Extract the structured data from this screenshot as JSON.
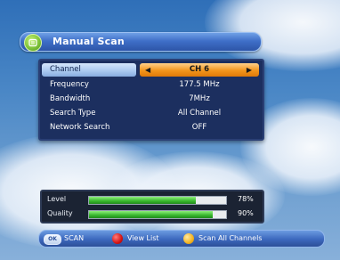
{
  "title": {
    "text": "Manual Scan",
    "icon": "satellite-dish-icon"
  },
  "settings": [
    {
      "label": "Channel",
      "value": "CH 6",
      "selected": true
    },
    {
      "label": "Frequency",
      "value": "177.5 MHz",
      "selected": false
    },
    {
      "label": "Bandwidth",
      "value": "7MHz",
      "selected": false
    },
    {
      "label": "Search Type",
      "value": "All Channel",
      "selected": false
    },
    {
      "label": "Network Search",
      "value": "OFF",
      "selected": false
    }
  ],
  "signal": {
    "level": {
      "label": "Level",
      "percent": 78,
      "percent_text": "78%"
    },
    "quality": {
      "label": "Quality",
      "percent": 90,
      "percent_text": "90%"
    }
  },
  "help": {
    "ok_key": "OK",
    "ok_label": "SCAN",
    "red_label": "View List",
    "yellow_label": "Scan All Channels"
  },
  "colors": {
    "selected_value": "#f2951c",
    "level_bar": "#36b52c",
    "panel_bg": "#1c2f5f"
  }
}
